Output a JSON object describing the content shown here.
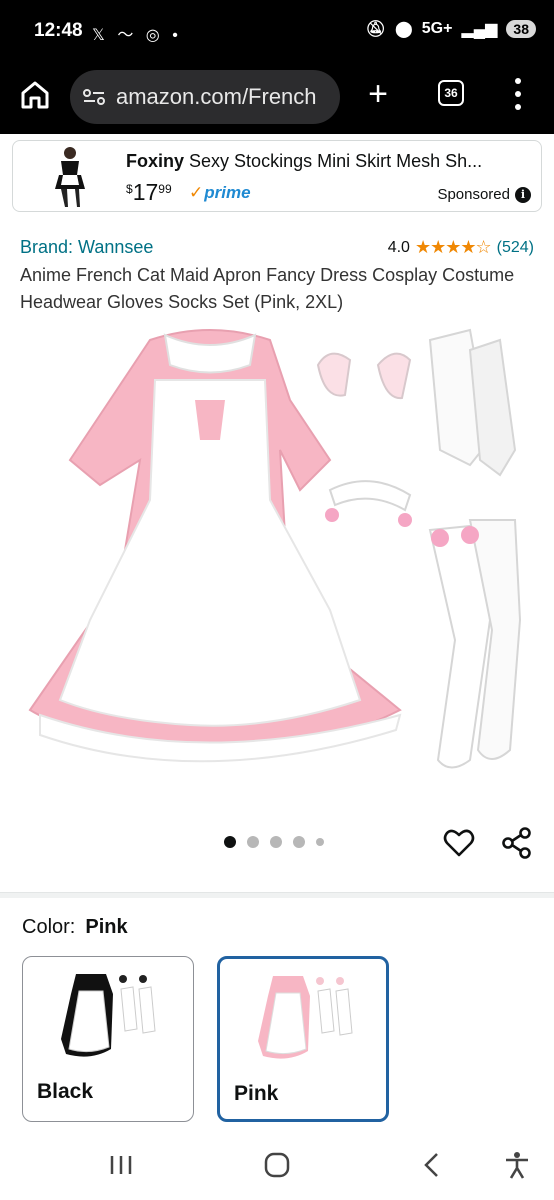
{
  "status_bar": {
    "time": "12:48",
    "network": "5G+",
    "battery": "38"
  },
  "browser": {
    "url": "amazon.com/French",
    "tab_count": "36"
  },
  "ad": {
    "brand": "Foxiny",
    "title": "Sexy Stockings Mini Skirt Mesh Sh...",
    "price_currency": "$",
    "price_whole": "17",
    "price_fraction": "99",
    "prime_label": "prime",
    "sponsored_label": "Sponsored"
  },
  "product": {
    "brand": "Brand: Wannsee",
    "rating_value": "4.0",
    "rating_stars": "★★★★☆",
    "rating_count": "(524)",
    "title": "Anime French Cat Maid Apron Fancy Dress Cosplay Costume Headwear Gloves Socks Set (Pink, 2XL)"
  },
  "variation": {
    "color_label": "Color:",
    "selected_color": "Pink",
    "options": [
      {
        "label": "Black",
        "selected": false
      },
      {
        "label": "Pink",
        "selected": true
      }
    ]
  },
  "colors": {
    "link": "#007185",
    "star": "#f08804",
    "prime": "#1f8ad2",
    "selected_border": "#2162a1",
    "dress_pink": "#f7b6c4",
    "apron_white": "#ffffff"
  },
  "icons": [
    "home-icon",
    "site-settings-icon",
    "new-tab-icon",
    "tab-switcher-icon",
    "more-menu-icon",
    "info-icon",
    "heart-icon",
    "share-icon",
    "recents-icon",
    "home-nav-icon",
    "back-icon",
    "accessibility-icon"
  ]
}
